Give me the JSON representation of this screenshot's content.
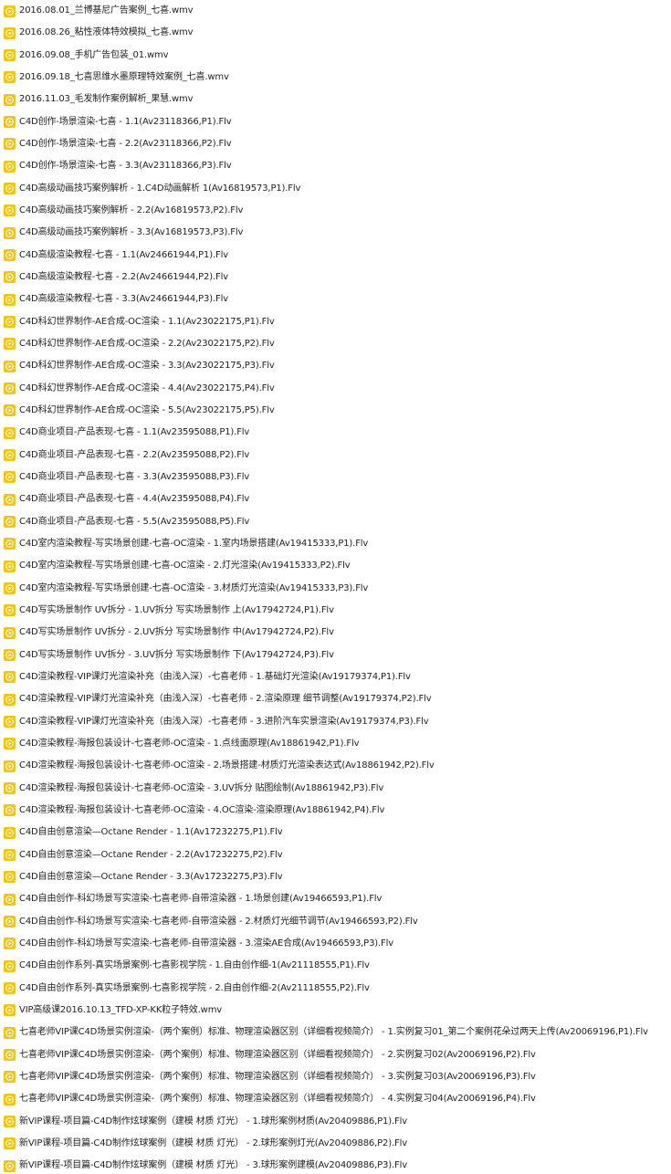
{
  "file_list": {
    "icon": "video-file-icon",
    "icon_color": "#f2c511",
    "files": [
      "2016.08.01_兰博基尼广告案例_七喜.wmv",
      "2016.08.26_粘性液体特效模拟_七喜.wmv",
      "2016.09.08_手机广告包装_01.wmv",
      "2016.09.18_七喜思维水墨原理特效案例_七喜.wmv",
      "2016.11.03_毛发制作案例解析_果慧.wmv",
      "C4D创作-场景渲染-七喜 - 1.1(Av23118366,P1).Flv",
      "C4D创作-场景渲染-七喜 - 2.2(Av23118366,P2).Flv",
      "C4D创作-场景渲染-七喜 - 3.3(Av23118366,P3).Flv",
      "C4D高级动画技巧案例解析 - 1.C4D动画解析 1(Av16819573,P1).Flv",
      "C4D高级动画技巧案例解析 - 2.2(Av16819573,P2).Flv",
      "C4D高级动画技巧案例解析 - 3.3(Av16819573,P3).Flv",
      "C4D高级渲染教程-七喜 - 1.1(Av24661944,P1).Flv",
      "C4D高级渲染教程-七喜 - 2.2(Av24661944,P2).Flv",
      "C4D高级渲染教程-七喜 - 3.3(Av24661944,P3).Flv",
      "C4D科幻世界制作-AE合成-OC渲染 - 1.1(Av23022175,P1).Flv",
      "C4D科幻世界制作-AE合成-OC渲染 - 2.2(Av23022175,P2).Flv",
      "C4D科幻世界制作-AE合成-OC渲染 - 3.3(Av23022175,P3).Flv",
      "C4D科幻世界制作-AE合成-OC渲染 - 4.4(Av23022175,P4).Flv",
      "C4D科幻世界制作-AE合成-OC渲染 - 5.5(Av23022175,P5).Flv",
      "C4D商业项目-产品表现-七喜 - 1.1(Av23595088,P1).Flv",
      "C4D商业项目-产品表现-七喜 - 2.2(Av23595088,P2).Flv",
      "C4D商业项目-产品表现-七喜 - 3.3(Av23595088,P3).Flv",
      "C4D商业项目-产品表现-七喜 - 4.4(Av23595088,P4).Flv",
      "C4D商业项目-产品表现-七喜 - 5.5(Av23595088,P5).Flv",
      "C4D室内渲染教程-写实场景创建-七喜-OC渲染 - 1.室内场景搭建(Av19415333,P1).Flv",
      "C4D室内渲染教程-写实场景创建-七喜-OC渲染 - 2.灯光渲染(Av19415333,P2).Flv",
      "C4D室内渲染教程-写实场景创建-七喜-OC渲染 - 3.材质灯光渲染(Av19415333,P3).Flv",
      "C4D写实场景制作 UV拆分 - 1.UV拆分  写实场景制作 上(Av17942724,P1).Flv",
      "C4D写实场景制作 UV拆分 - 2.UV拆分  写实场景制作 中(Av17942724,P2).Flv",
      "C4D写实场景制作 UV拆分 - 3.UV拆分  写实场景制作 下(Av17942724,P3).Flv",
      "C4D渲染教程-VIP课灯光渲染补充（由浅入深）-七喜老师 - 1.基础灯光渲染(Av19179374,P1).Flv",
      "C4D渲染教程-VIP课灯光渲染补充（由浅入深）-七喜老师 - 2.渲染原理  细节调整(Av19179374,P2).Flv",
      "C4D渲染教程-VIP课灯光渲染补充（由浅入深）-七喜老师 - 3.进阶汽车实景渲染(Av19179374,P3).Flv",
      "C4D渲染教程-海报包装设计-七喜老师-OC渲染 - 1.点线面原理(Av18861942,P1).Flv",
      "C4D渲染教程-海报包装设计-七喜老师-OC渲染 - 2.场景搭建-材质灯光渲染表达式(Av18861942,P2).Flv",
      "C4D渲染教程-海报包装设计-七喜老师-OC渲染 - 3.UV拆分 贴图绘制(Av18861942,P3).Flv",
      "C4D渲染教程-海报包装设计-七喜老师-OC渲染 - 4.OC渲染-渲染原理(Av18861942,P4).Flv",
      "C4D自由创意渲染—Octane Render - 1.1(Av17232275,P1).Flv",
      "C4D自由创意渲染—Octane Render - 2.2(Av17232275,P2).Flv",
      "C4D自由创意渲染—Octane Render - 3.3(Av17232275,P3).Flv",
      "C4D自由创作-科幻场景写实渲染-七喜老师-自带渲染器 - 1.场景创建(Av19466593,P1).Flv",
      "C4D自由创作-科幻场景写实渲染-七喜老师-自带渲染器 - 2.材质灯光细节调节(Av19466593,P2).Flv",
      "C4D自由创作-科幻场景写实渲染-七喜老师-自带渲染器 - 3.渲染AE合成(Av19466593,P3).Flv",
      "C4D自由创作系列-真实场景案例-七喜影视学院 - 1.自由创作细-1(Av21118555,P1).Flv",
      "C4D自由创作系列-真实场景案例-七喜影视学院 - 2.自由创作细-2(Av21118555,P2).Flv",
      "VIP高级课2016.10.13_TFD-XP-KK粒子特效.wmv",
      "七喜老师VIP课C4D场景实例渲染-（两个案例）标准、物理渲染器区别（详细看视频简介） - 1.实例复习01_第二个案例花朵过两天上传(Av20069196,P1).Flv",
      "七喜老师VIP课C4D场景实例渲染-（两个案例）标准、物理渲染器区别（详细看视频简介） - 2.实例复习02(Av20069196,P2).Flv",
      "七喜老师VIP课C4D场景实例渲染-（两个案例）标准、物理渲染器区别（详细看视频简介） - 3.实例复习03(Av20069196,P3).Flv",
      "七喜老师VIP课C4D场景实例渲染-（两个案例）标准、物理渲染器区别（详细看视频简介） - 4.实例复习04(Av20069196,P4).Flv",
      "新VIP课程-项目篇-C4D制作炫球案例（建模 材质 灯光） - 1.球形案例材质(Av20409886,P1).Flv",
      "新VIP课程-项目篇-C4D制作炫球案例（建模 材质 灯光） - 2.球形案例灯光(Av20409886,P2).Flv",
      "新VIP课程-项目篇-C4D制作炫球案例（建模 材质 灯光） - 3.球形案例建模(Av20409886,P3).Flv"
    ]
  }
}
